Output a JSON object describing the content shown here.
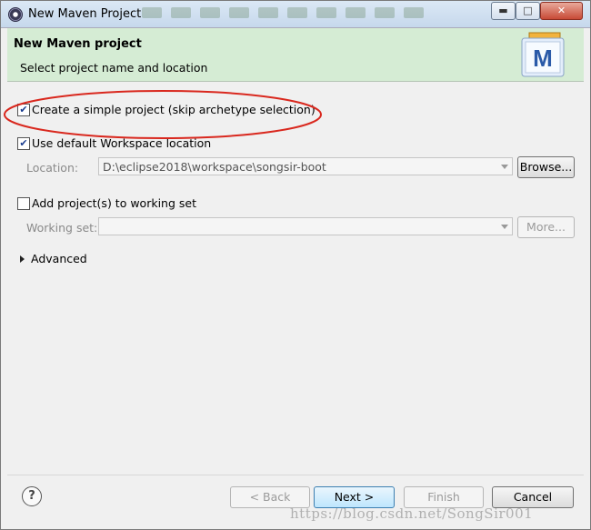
{
  "window": {
    "title": "New Maven Project",
    "controls": {
      "minimize": "▬",
      "maximize": "□",
      "close": "✕"
    }
  },
  "header": {
    "title": "New Maven project",
    "description": "Select project name and location",
    "logo_letter": "M",
    "logo_icon": "maven-icon"
  },
  "options": {
    "simple_project": {
      "label": "Create a simple project (skip archetype selection)",
      "checked": true
    },
    "default_workspace": {
      "label": "Use default Workspace location",
      "checked": true
    },
    "location": {
      "label": "Location:",
      "value": "D:\\eclipse2018\\workspace\\songsir-boot",
      "browse_label": "Browse..."
    },
    "working_set_toggle": {
      "label": "Add project(s) to working set",
      "checked": false
    },
    "working_set": {
      "label": "Working set:",
      "value": "",
      "more_label": "More..."
    },
    "advanced": {
      "label": "Advanced"
    }
  },
  "footer": {
    "help_symbol": "?",
    "back_label": "< Back",
    "next_label": "Next >",
    "finish_label": "Finish",
    "cancel_label": "Cancel"
  },
  "watermark": "https://blog.csdn.net/SongSir001",
  "colors": {
    "banner": "#d5ecd4",
    "annotation": "#d9281e",
    "default_button": "#3c7fb1"
  }
}
